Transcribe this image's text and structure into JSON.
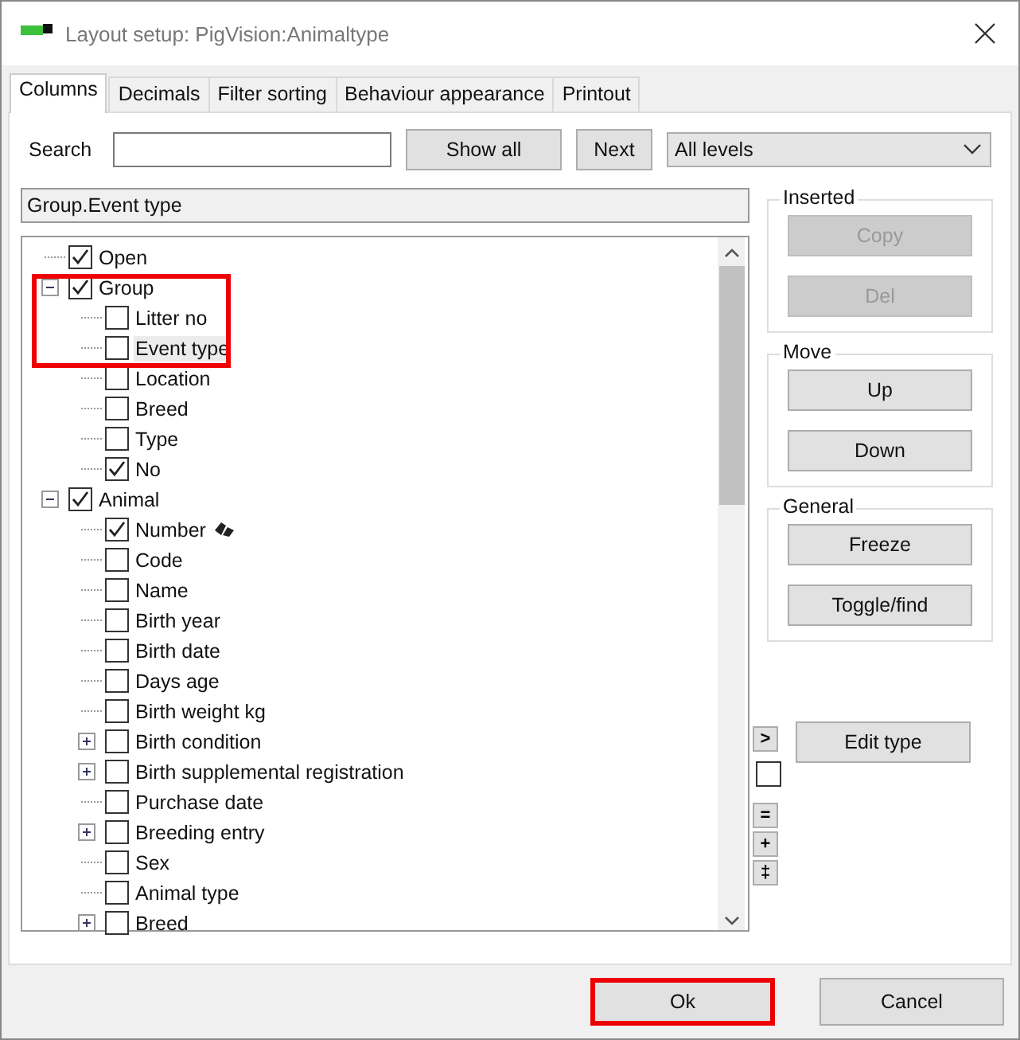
{
  "window": {
    "title": "Layout setup: PigVision:Animaltype"
  },
  "tabs": [
    {
      "label": "Columns",
      "selected": true
    },
    {
      "label": "Decimals",
      "selected": false
    },
    {
      "label": "Filter sorting",
      "selected": false
    },
    {
      "label": "Behaviour  appearance",
      "selected": false
    },
    {
      "label": "Printout",
      "selected": false
    }
  ],
  "search": {
    "label": "Search"
  },
  "show_all_button": "Show all",
  "next_button": "Next",
  "level_dropdown": "All levels",
  "path_field": "Group.Event type",
  "tree": [
    {
      "label": "Open",
      "checked": true
    },
    {
      "label": "Group",
      "checked": true,
      "expanded": true,
      "highlighted": true,
      "children": [
        {
          "label": "Litter no",
          "checked": false,
          "highlighted": true
        },
        {
          "label": "Event type",
          "checked": false,
          "highlighted": true,
          "selected": true
        },
        {
          "label": "Location",
          "checked": false
        },
        {
          "label": "Breed",
          "checked": false
        },
        {
          "label": "Type",
          "checked": false
        },
        {
          "label": "No",
          "checked": true
        }
      ]
    },
    {
      "label": "Animal",
      "checked": true,
      "expanded": true,
      "children": [
        {
          "label": "Number",
          "checked": true,
          "find": true
        },
        {
          "label": "Code",
          "checked": false
        },
        {
          "label": "Name",
          "checked": false
        },
        {
          "label": "Birth year",
          "checked": false
        },
        {
          "label": "Birth date",
          "checked": false
        },
        {
          "label": "Days age",
          "checked": false
        },
        {
          "label": "Birth weight kg",
          "checked": false
        },
        {
          "label": "Birth condition",
          "checked": false,
          "expanded": false
        },
        {
          "label": "Birth supplemental registration",
          "checked": false,
          "expanded": false
        },
        {
          "label": "Purchase date",
          "checked": false
        },
        {
          "label": "Breeding entry",
          "checked": false,
          "expanded": false
        },
        {
          "label": "Sex",
          "checked": false
        },
        {
          "label": "Animal type",
          "checked": false
        },
        {
          "label": "Breed",
          "checked": false,
          "expanded": false
        }
      ]
    }
  ],
  "groups": [
    {
      "title": "Inserted",
      "buttons": [
        {
          "label": "Copy",
          "disabled": true
        },
        {
          "label": "Del",
          "disabled": true
        }
      ]
    },
    {
      "title": "Move",
      "buttons": [
        {
          "label": "Up",
          "disabled": false
        },
        {
          "label": "Down",
          "disabled": false
        }
      ]
    },
    {
      "title": "General",
      "buttons": [
        {
          "label": "Freeze",
          "disabled": false
        },
        {
          "label": "Toggle/find",
          "disabled": false
        }
      ]
    }
  ],
  "side_tools": {
    "arrow": ">",
    "checkbox_checked": false,
    "small_buttons": [
      "=",
      "+",
      "‡"
    ]
  },
  "edit_type_button": "Edit type",
  "footer_buttons": [
    {
      "label": "Ok",
      "highlighted": true
    },
    {
      "label": "Cancel",
      "highlighted": false
    }
  ]
}
